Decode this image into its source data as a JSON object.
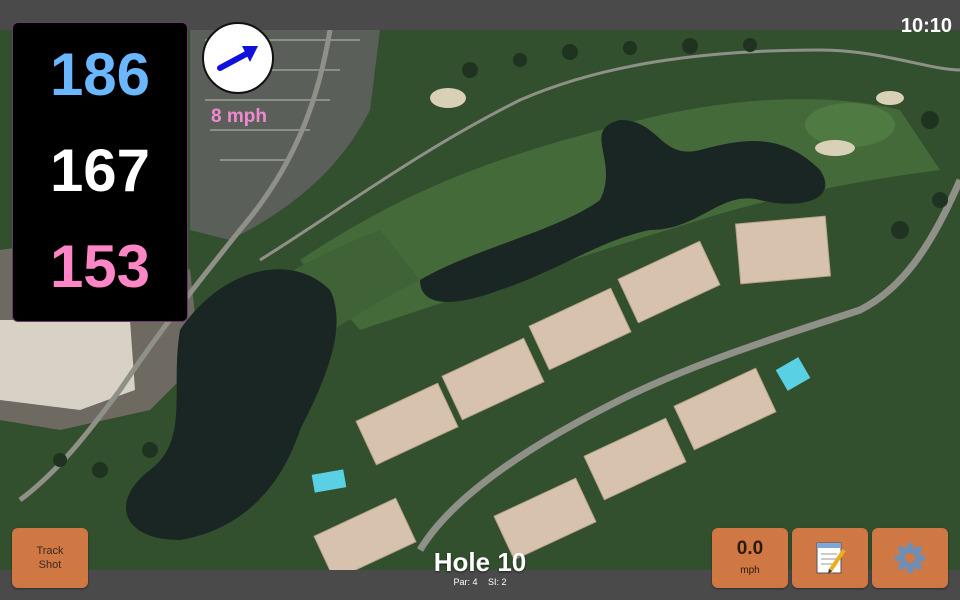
{
  "clock": {
    "time": "10:10"
  },
  "distances": {
    "back": "186",
    "middle": "167",
    "front": "153"
  },
  "wind": {
    "speed_label": "8 mph",
    "direction_icon": "arrow-icon"
  },
  "buttons": {
    "track_shot_line1": "Track",
    "track_shot_line2": "Shot",
    "speed_value": "0.0",
    "speed_unit": "mph",
    "notes_icon": "notepad-icon",
    "settings_icon": "gear-icon"
  },
  "hole": {
    "title": "Hole 10",
    "par": "Par: 4",
    "si": "SI: 2"
  },
  "colors": {
    "back_distance": "#6ab6ff",
    "middle_distance": "#ffffff",
    "front_distance": "#ff86c6",
    "wind_label": "#f08ad0",
    "button_orange": "#d07844"
  }
}
